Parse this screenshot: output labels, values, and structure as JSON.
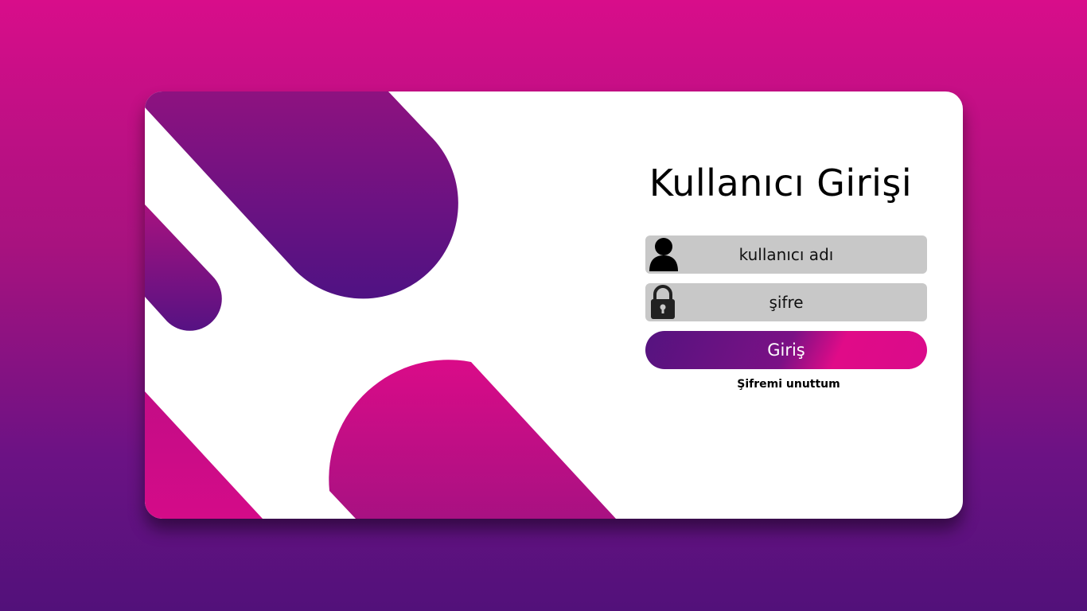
{
  "login": {
    "title": "Kullanıcı Girişi",
    "username_placeholder": "kullanıcı adı",
    "password_placeholder": "şifre",
    "submit_label": "Giriş",
    "forgot_password_label": "Şifremi unuttum"
  },
  "icons": {
    "username": "user-silhouette-icon",
    "password": "padlock-icon"
  },
  "colors": {
    "background_top": "#d80d8a",
    "background_bottom": "#52117a",
    "accent_pink": "#da0b8a",
    "accent_purple": "#55137f",
    "field_background": "#c8c8c8",
    "card_background": "#ffffff"
  }
}
